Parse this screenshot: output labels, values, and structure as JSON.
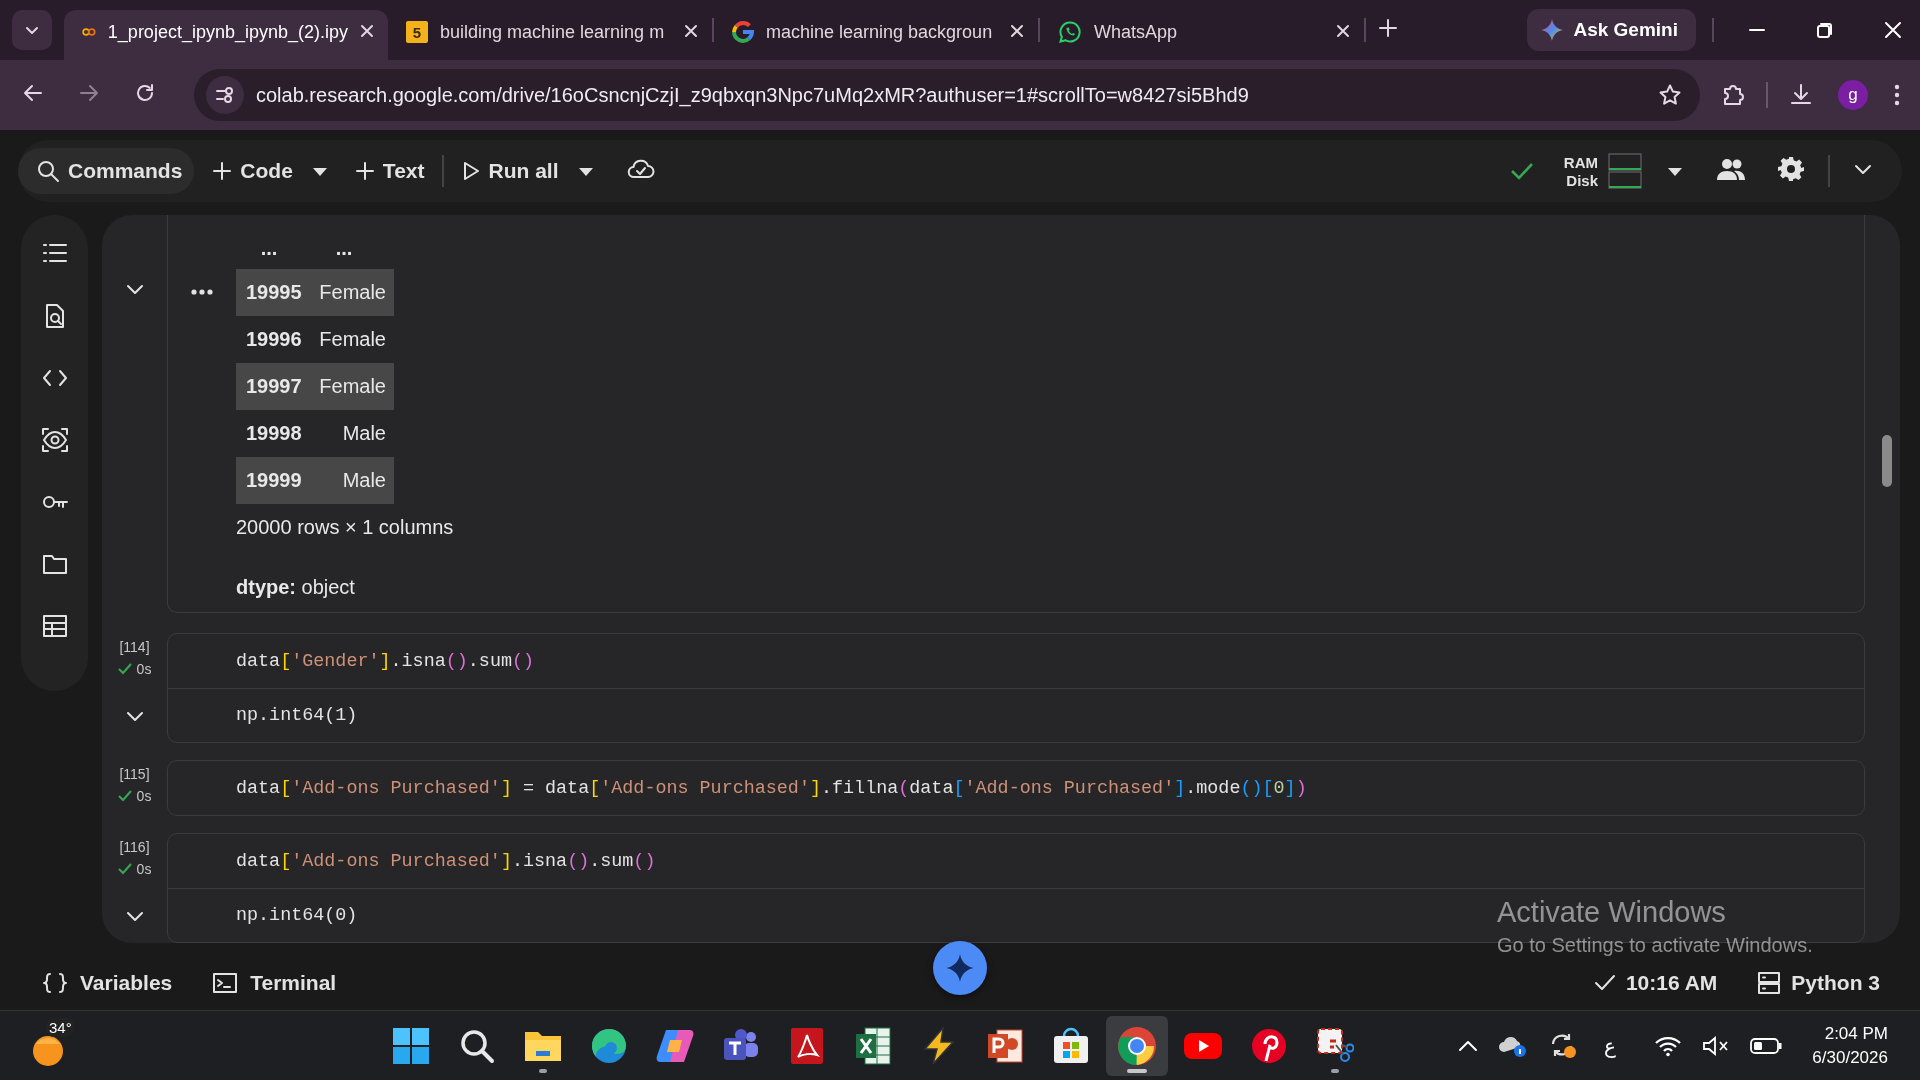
{
  "browser": {
    "tabs": [
      {
        "title": "1_project_ipynb_ipynb_(2).ipy",
        "kind": "colab",
        "selected": true
      },
      {
        "title": "building machine learning m",
        "kind": "badge",
        "badge": "5",
        "selected": false
      },
      {
        "title": "machine learning backgroun",
        "kind": "google",
        "selected": false
      },
      {
        "title": "WhatsApp",
        "kind": "whatsapp",
        "selected": false
      }
    ],
    "ask_gemini": "Ask Gemini",
    "url": "colab.research.google.com/drive/16oCsncnjCzjI_z9qbxqn3Npc7uMq2xMR?authuser=1#scrollTo=w8427si5Bhd9",
    "profile_initial": "g"
  },
  "toolbar": {
    "commands": "Commands",
    "code": "Code",
    "text": "Text",
    "run_all": "Run all",
    "ram": "RAM",
    "disk": "Disk"
  },
  "output_series": {
    "ellipsis": [
      "...",
      "..."
    ],
    "rows": [
      {
        "index": "19995",
        "value": "Female",
        "shaded": true
      },
      {
        "index": "19996",
        "value": "Female",
        "shaded": false
      },
      {
        "index": "19997",
        "value": "Female",
        "shaded": true
      },
      {
        "index": "19998",
        "value": "Male",
        "shaded": false
      },
      {
        "index": "19999",
        "value": "Male",
        "shaded": true
      }
    ],
    "shape": "20000 rows × 1 columns",
    "dtype_label": "dtype:",
    "dtype": "object"
  },
  "cells": [
    {
      "count": "[114]",
      "time": "0s",
      "code": [
        {
          "text": "data",
          "kind": "plain"
        },
        {
          "text": "[",
          "kind": "bracket1"
        },
        {
          "text": "'Gender'",
          "kind": "string"
        },
        {
          "text": "]",
          "kind": "bracket1"
        },
        {
          "text": ".isna",
          "kind": "plain"
        },
        {
          "text": "()",
          "kind": "bracket2"
        },
        {
          "text": ".sum",
          "kind": "plain"
        },
        {
          "text": "()",
          "kind": "bracket2"
        }
      ],
      "output": "np.int64(1)"
    },
    {
      "count": "[115]",
      "time": "0s",
      "code": [
        {
          "text": "data",
          "kind": "plain"
        },
        {
          "text": "[",
          "kind": "bracket1"
        },
        {
          "text": "'Add-ons Purchased'",
          "kind": "string"
        },
        {
          "text": "]",
          "kind": "bracket1"
        },
        {
          "text": " = data",
          "kind": "plain"
        },
        {
          "text": "[",
          "kind": "bracket1"
        },
        {
          "text": "'Add-ons Purchased'",
          "kind": "string"
        },
        {
          "text": "]",
          "kind": "bracket1"
        },
        {
          "text": ".fillna",
          "kind": "plain"
        },
        {
          "text": "(",
          "kind": "bracket2"
        },
        {
          "text": "data",
          "kind": "plain"
        },
        {
          "text": "[",
          "kind": "bracket3"
        },
        {
          "text": "'Add-ons Purchased'",
          "kind": "string"
        },
        {
          "text": "]",
          "kind": "bracket3"
        },
        {
          "text": ".mode",
          "kind": "plain"
        },
        {
          "text": "()",
          "kind": "bracket3"
        },
        {
          "text": "[",
          "kind": "bracket3"
        },
        {
          "text": "0",
          "kind": "number"
        },
        {
          "text": "]",
          "kind": "bracket3"
        },
        {
          "text": ")",
          "kind": "bracket2"
        }
      ]
    },
    {
      "count": "[116]",
      "time": "0s",
      "code": [
        {
          "text": "data",
          "kind": "plain"
        },
        {
          "text": "[",
          "kind": "bracket1"
        },
        {
          "text": "'Add-ons Purchased'",
          "kind": "string"
        },
        {
          "text": "]",
          "kind": "bracket1"
        },
        {
          "text": ".isna",
          "kind": "plain"
        },
        {
          "text": "()",
          "kind": "bracket2"
        },
        {
          "text": ".sum",
          "kind": "plain"
        },
        {
          "text": "()",
          "kind": "bracket2"
        }
      ],
      "output": "np.int64(0)"
    }
  ],
  "status_bar": {
    "variables": "Variables",
    "terminal": "Terminal",
    "last_run": "10:16 AM",
    "runtime": "Python 3"
  },
  "activation_notice": {
    "title": "Activate Windows",
    "text": "Go to Settings to activate Windows."
  },
  "taskbar": {
    "weather": "34°",
    "apps": [
      {
        "kind": "start",
        "running": false,
        "selected": false
      },
      {
        "kind": "search",
        "running": false,
        "selected": false
      },
      {
        "kind": "explorer",
        "running": true,
        "selected": false
      },
      {
        "kind": "edge",
        "running": false,
        "selected": false
      },
      {
        "kind": "copilot",
        "running": false,
        "selected": false
      },
      {
        "kind": "teams",
        "running": false,
        "selected": false
      },
      {
        "kind": "acrobat",
        "running": false,
        "selected": false
      },
      {
        "kind": "excel",
        "running": false,
        "selected": false
      },
      {
        "kind": "winamp",
        "running": false,
        "selected": false
      },
      {
        "kind": "powerpoint",
        "running": false,
        "selected": false
      },
      {
        "kind": "store",
        "running": false,
        "selected": false
      },
      {
        "kind": "chrome",
        "running": true,
        "selected": true
      },
      {
        "kind": "youtube",
        "running": false,
        "selected": false
      },
      {
        "kind": "pinterest",
        "running": false,
        "selected": false
      },
      {
        "kind": "snipping",
        "running": true,
        "selected": false
      }
    ],
    "language": "ع",
    "time": "2:04 PM",
    "date": "6/30/2026"
  }
}
